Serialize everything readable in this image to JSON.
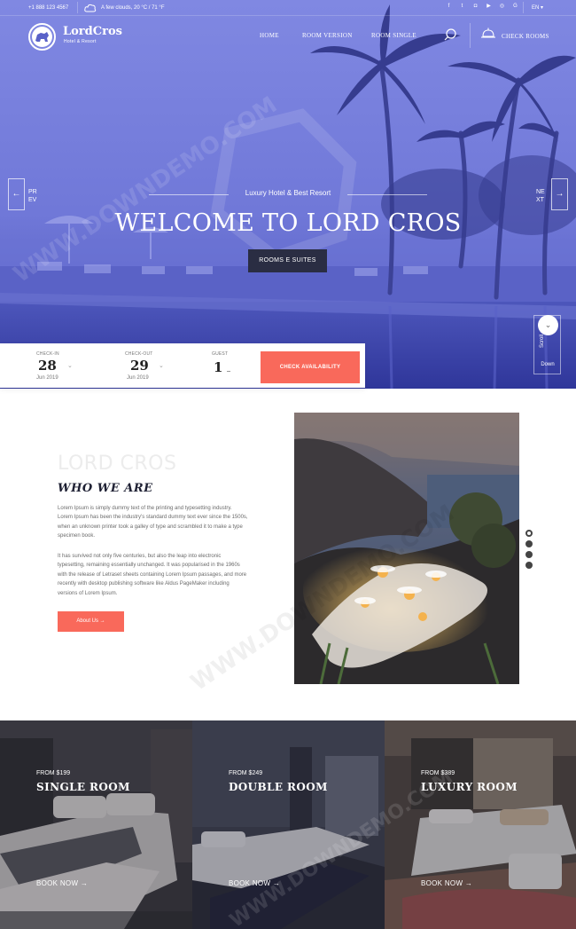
{
  "topbar": {
    "phone": "+1 888 123 4567",
    "weather": "A few clouds, 20 °C / 71 °F",
    "socials": [
      "facebook-icon",
      "twitter-icon",
      "instagram-icon",
      "youtube-icon",
      "dribbble-icon",
      "google-icon"
    ],
    "language": "EN ▾"
  },
  "brand": {
    "name": "LordCros",
    "tagline": "Hotel & Resort"
  },
  "nav": {
    "items": [
      "HOME",
      "ROOM VERSION",
      "ROOM SINGLE"
    ],
    "cta": "CHECK ROOMS"
  },
  "hero": {
    "subtitle": "Luxury Hotel & Best Resort",
    "title": "WELCOME TO LORD CROS",
    "button": "ROOMS E SUITES",
    "prev": [
      "PR",
      "EV"
    ],
    "next": [
      "NE",
      "XT"
    ],
    "scroll": [
      "Scroll",
      "Down"
    ]
  },
  "booking": {
    "checkin": {
      "label": "CHECK-IN",
      "day": "28",
      "month": "Jun 2019"
    },
    "checkout": {
      "label": "CHECK-OUT",
      "day": "29",
      "month": "Jun 2019"
    },
    "guest": {
      "label": "GUEST",
      "count": "1"
    },
    "button": "CHECK AVAILABILITY"
  },
  "about": {
    "ghost": "LORD CROS",
    "title": "WHO WE ARE",
    "paragraph1": [
      "Lorem Ipsum is simply dummy text of the printing and typesetting industry.",
      "Lorem Ipsum has been the industry's standard dummy text ever since the 1500s,",
      "when an unknown printer took a galley of type and scrambled it to make a type",
      "specimen book."
    ],
    "paragraph2": [
      "It has survived not only five centuries, but also the leap into electronic",
      "typesetting, remaining essentially unchanged. It was popularised in the 1960s",
      "with the release of Letraset sheets containing Lorem Ipsum passages, and more",
      "recently with desktop publishing software like Aldus PageMaker including",
      "versions of Lorem Ipsum."
    ],
    "button": "About Us →",
    "slides": 4,
    "active_slide": 1
  },
  "rooms": [
    {
      "price": "FROM $199",
      "name": "SINGLE ROOM",
      "cta": "BOOK NOW →"
    },
    {
      "price": "FROM $249",
      "name": "DOUBLE ROOM",
      "cta": "BOOK NOW →"
    },
    {
      "price": "FROM $389",
      "name": "LUXURY ROOM",
      "cta": "BOOK NOW →"
    }
  ],
  "watermark": "WWW.DOWNDEMO.COM",
  "colors": {
    "accent": "#f9695b",
    "dark": "#2a2d43",
    "hero_overlay": "#5a62c8"
  }
}
